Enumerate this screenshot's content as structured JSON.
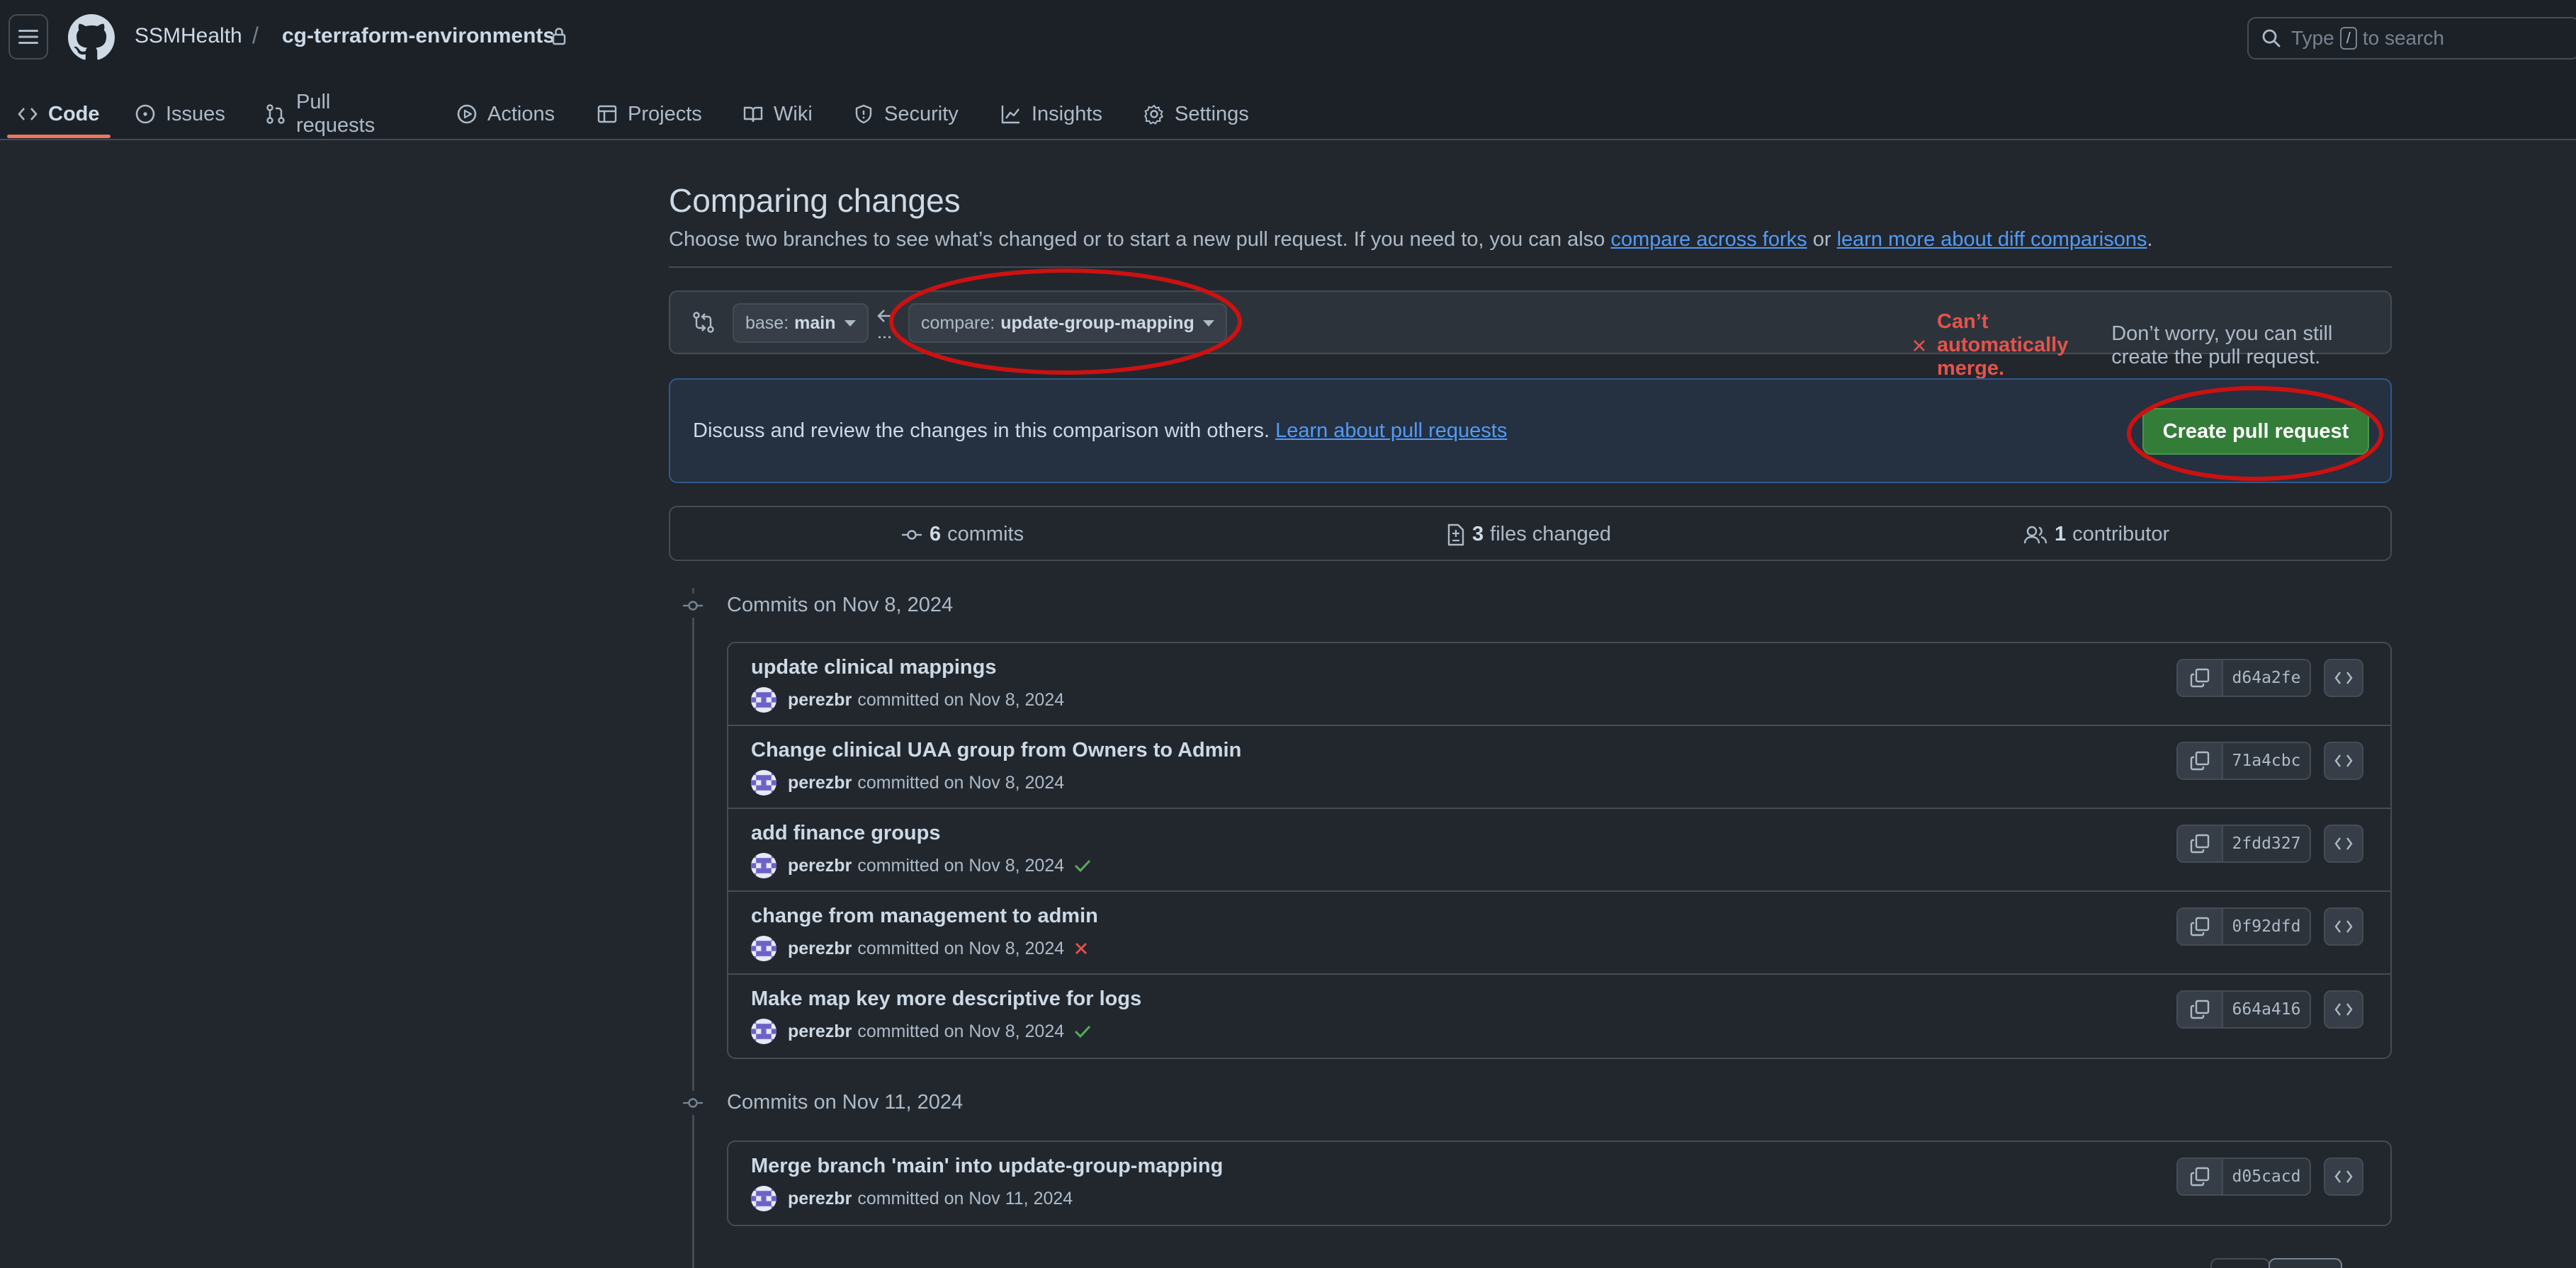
{
  "header": {
    "owner": "SSMHealth",
    "separator": "/",
    "repo": "cg-terraform-environments",
    "search_prefix": "Type",
    "search_key": "/",
    "search_suffix": "to search"
  },
  "nav": {
    "tabs": [
      {
        "label": "Code",
        "icon": "code-icon",
        "active": true
      },
      {
        "label": "Issues",
        "icon": "issue-icon"
      },
      {
        "label": "Pull requests",
        "icon": "git-pull-request-icon"
      },
      {
        "label": "Actions",
        "icon": "play-icon"
      },
      {
        "label": "Projects",
        "icon": "table-icon"
      },
      {
        "label": "Wiki",
        "icon": "book-icon"
      },
      {
        "label": "Security",
        "icon": "shield-icon"
      },
      {
        "label": "Insights",
        "icon": "graph-icon"
      },
      {
        "label": "Settings",
        "icon": "gear-icon"
      }
    ]
  },
  "compare": {
    "title": "Comparing changes",
    "subtitle_text": "Choose two branches to see what’s changed or to start a new pull request. If you need to, you can also",
    "link_forks": "compare across forks",
    "or_text": "or",
    "link_learn": "learn more about diff comparisons",
    "period": ".",
    "base_prefix": "base:",
    "base_branch": "main",
    "compare_prefix": "compare:",
    "compare_branch": "update-group-mapping",
    "merge_status": "Can’t automatically merge.",
    "merge_note": "Don’t worry, you can still create the pull request."
  },
  "discuss": {
    "text": "Discuss and review the changes in this comparison with others.",
    "link": "Learn about pull requests",
    "button": "Create pull request"
  },
  "stats": {
    "commits_count": "6",
    "commits_label": "commits",
    "files_count": "3",
    "files_label": "files changed",
    "contributors_count": "1",
    "contributors_label": "contributor"
  },
  "commit_groups": [
    {
      "title": "Commits on Nov 8, 2024",
      "commits": [
        {
          "message": "update clinical mappings",
          "author": "perezbr",
          "date": "committed on Nov 8, 2024",
          "sha": "d64a2fe",
          "status": "none"
        },
        {
          "message": "Change clinical UAA group from Owners to Admin",
          "author": "perezbr",
          "date": "committed on Nov 8, 2024",
          "sha": "71a4cbc",
          "status": "none"
        },
        {
          "message": "add finance groups",
          "author": "perezbr",
          "date": "committed on Nov 8, 2024",
          "sha": "2fdd327",
          "status": "success"
        },
        {
          "message": "change from management to admin",
          "author": "perezbr",
          "date": "committed on Nov 8, 2024",
          "sha": "0f92dfd",
          "status": "failure"
        },
        {
          "message": "Make map key more descriptive for logs",
          "author": "perezbr",
          "date": "committed on Nov 8, 2024",
          "sha": "664a416",
          "status": "success"
        }
      ]
    },
    {
      "title": "Commits on Nov 11, 2024",
      "commits": [
        {
          "message": "Merge branch 'main' into update-group-mapping",
          "author": "perezbr",
          "date": "committed on Nov 11, 2024",
          "sha": "d05cacd",
          "status": "none"
        }
      ]
    }
  ],
  "colors": {
    "success": "#57ab5a",
    "failure": "#e5534b",
    "annotation": "#cc1111",
    "primary_button": "#347d39",
    "link": "#539bf5"
  }
}
